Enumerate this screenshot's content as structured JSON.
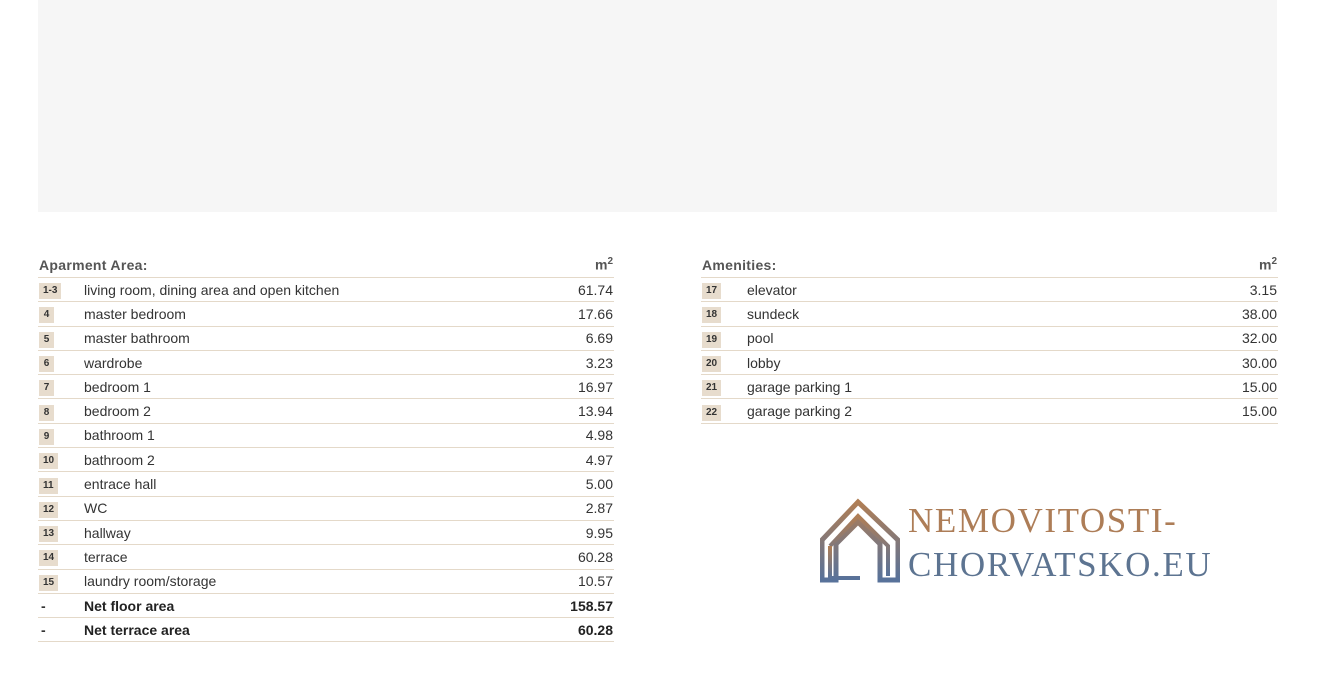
{
  "apartment": {
    "title": "Aparment Area:",
    "unit": "m",
    "unit_sup": "2",
    "rows": [
      {
        "num": "1-3",
        "name": "living room, dining area and open kitchen",
        "value": "61.74"
      },
      {
        "num": "4",
        "name": "master bedroom",
        "value": "17.66"
      },
      {
        "num": "5",
        "name": "master bathroom",
        "value": "6.69"
      },
      {
        "num": "6",
        "name": "wardrobe",
        "value": "3.23"
      },
      {
        "num": "7",
        "name": "bedroom 1",
        "value": "16.97"
      },
      {
        "num": "8",
        "name": "bedroom 2",
        "value": "13.94"
      },
      {
        "num": "9",
        "name": "bathroom 1",
        "value": "4.98"
      },
      {
        "num": "10",
        "name": "bathroom 2",
        "value": "4.97"
      },
      {
        "num": "11",
        "name": "entrace hall",
        "value": "5.00"
      },
      {
        "num": "12",
        "name": "WC",
        "value": "2.87"
      },
      {
        "num": "13",
        "name": "hallway",
        "value": "9.95"
      },
      {
        "num": "14",
        "name": "terrace",
        "value": "60.28"
      },
      {
        "num": "15",
        "name": "laundry room/storage",
        "value": "10.57"
      }
    ],
    "totals": [
      {
        "num": "-",
        "name": "Net floor area",
        "value": "158.57"
      },
      {
        "num": "-",
        "name": "Net terrace area",
        "value": "60.28"
      }
    ]
  },
  "amenities": {
    "title": "Amenities:",
    "unit": "m",
    "unit_sup": "2",
    "rows": [
      {
        "num": "17",
        "name": "elevator",
        "value": "3.15"
      },
      {
        "num": "18",
        "name": "sundeck",
        "value": "38.00"
      },
      {
        "num": "19",
        "name": "pool",
        "value": "32.00"
      },
      {
        "num": "20",
        "name": "lobby",
        "value": "30.00"
      },
      {
        "num": "21",
        "name": "garage parking 1",
        "value": "15.00"
      },
      {
        "num": "22",
        "name": "garage parking 2",
        "value": "15.00"
      }
    ]
  },
  "logo": {
    "line1": "NEMOVITOSTI-",
    "line2": "CHORVATSKO.EU",
    "icon": "house-icon",
    "colors": {
      "copper": "#ad7d57",
      "blue": "#5d7491"
    }
  }
}
